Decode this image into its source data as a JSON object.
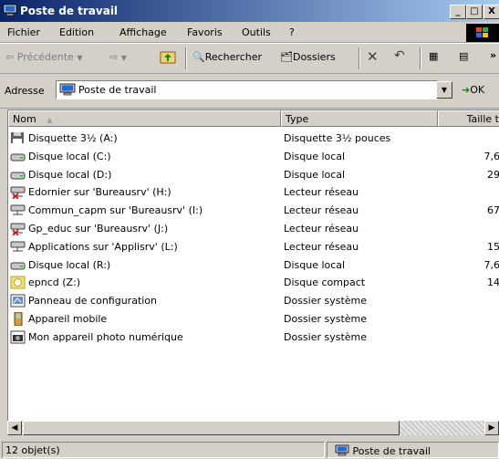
{
  "window": {
    "title": "Poste de travail"
  },
  "caption_buttons": {
    "minimize": "_",
    "maximize": "□",
    "close": "X"
  },
  "menu": [
    "Fichier",
    "Edition",
    "Affichage",
    "Favoris",
    "Outils",
    "?"
  ],
  "toolbar": {
    "back": "Précédente",
    "search": "Rechercher",
    "folders": "Dossiers",
    "more": "»"
  },
  "address": {
    "label": "Adresse",
    "value": "Poste de travail",
    "go": "OK"
  },
  "columns": {
    "name": "Nom",
    "type": "Type",
    "size": "Taille t"
  },
  "items": [
    {
      "name": "Disquette 3½ (A:)",
      "type": "Disquette 3½ pouces",
      "size": "",
      "icon": "floppy-icon"
    },
    {
      "name": "Disque local (C:)",
      "type": "Disque local",
      "size": "7,6",
      "icon": "hard-drive-icon"
    },
    {
      "name": "Disque local (D:)",
      "type": "Disque local",
      "size": "29",
      "icon": "hard-drive-icon"
    },
    {
      "name": "Edornier sur 'Bureausrv' (H:)",
      "type": "Lecteur réseau",
      "size": "",
      "icon": "network-drive-disconnected-icon"
    },
    {
      "name": "Commun_capm sur 'Bureausrv' (I:)",
      "type": "Lecteur réseau",
      "size": "67",
      "icon": "network-drive-icon"
    },
    {
      "name": "Gp_educ sur 'Bureausrv' (J:)",
      "type": "Lecteur réseau",
      "size": "",
      "icon": "network-drive-disconnected-icon"
    },
    {
      "name": "Applications sur 'Applisrv' (L:)",
      "type": "Lecteur réseau",
      "size": "15",
      "icon": "network-drive-icon"
    },
    {
      "name": "Disque local (R:)",
      "type": "Disque local",
      "size": "7,6",
      "icon": "hard-drive-icon"
    },
    {
      "name": "epncd (Z:)",
      "type": "Disque compact",
      "size": "14",
      "icon": "cd-drive-icon"
    },
    {
      "name": "Panneau de configuration",
      "type": "Dossier système",
      "size": "",
      "icon": "control-panel-icon"
    },
    {
      "name": "Appareil mobile",
      "type": "Dossier système",
      "size": "",
      "icon": "mobile-device-icon"
    },
    {
      "name": "Mon appareil photo numérique",
      "type": "Dossier système",
      "size": "",
      "icon": "camera-icon"
    }
  ],
  "status": {
    "count": "12 objet(s)",
    "location": "Poste de travail"
  }
}
